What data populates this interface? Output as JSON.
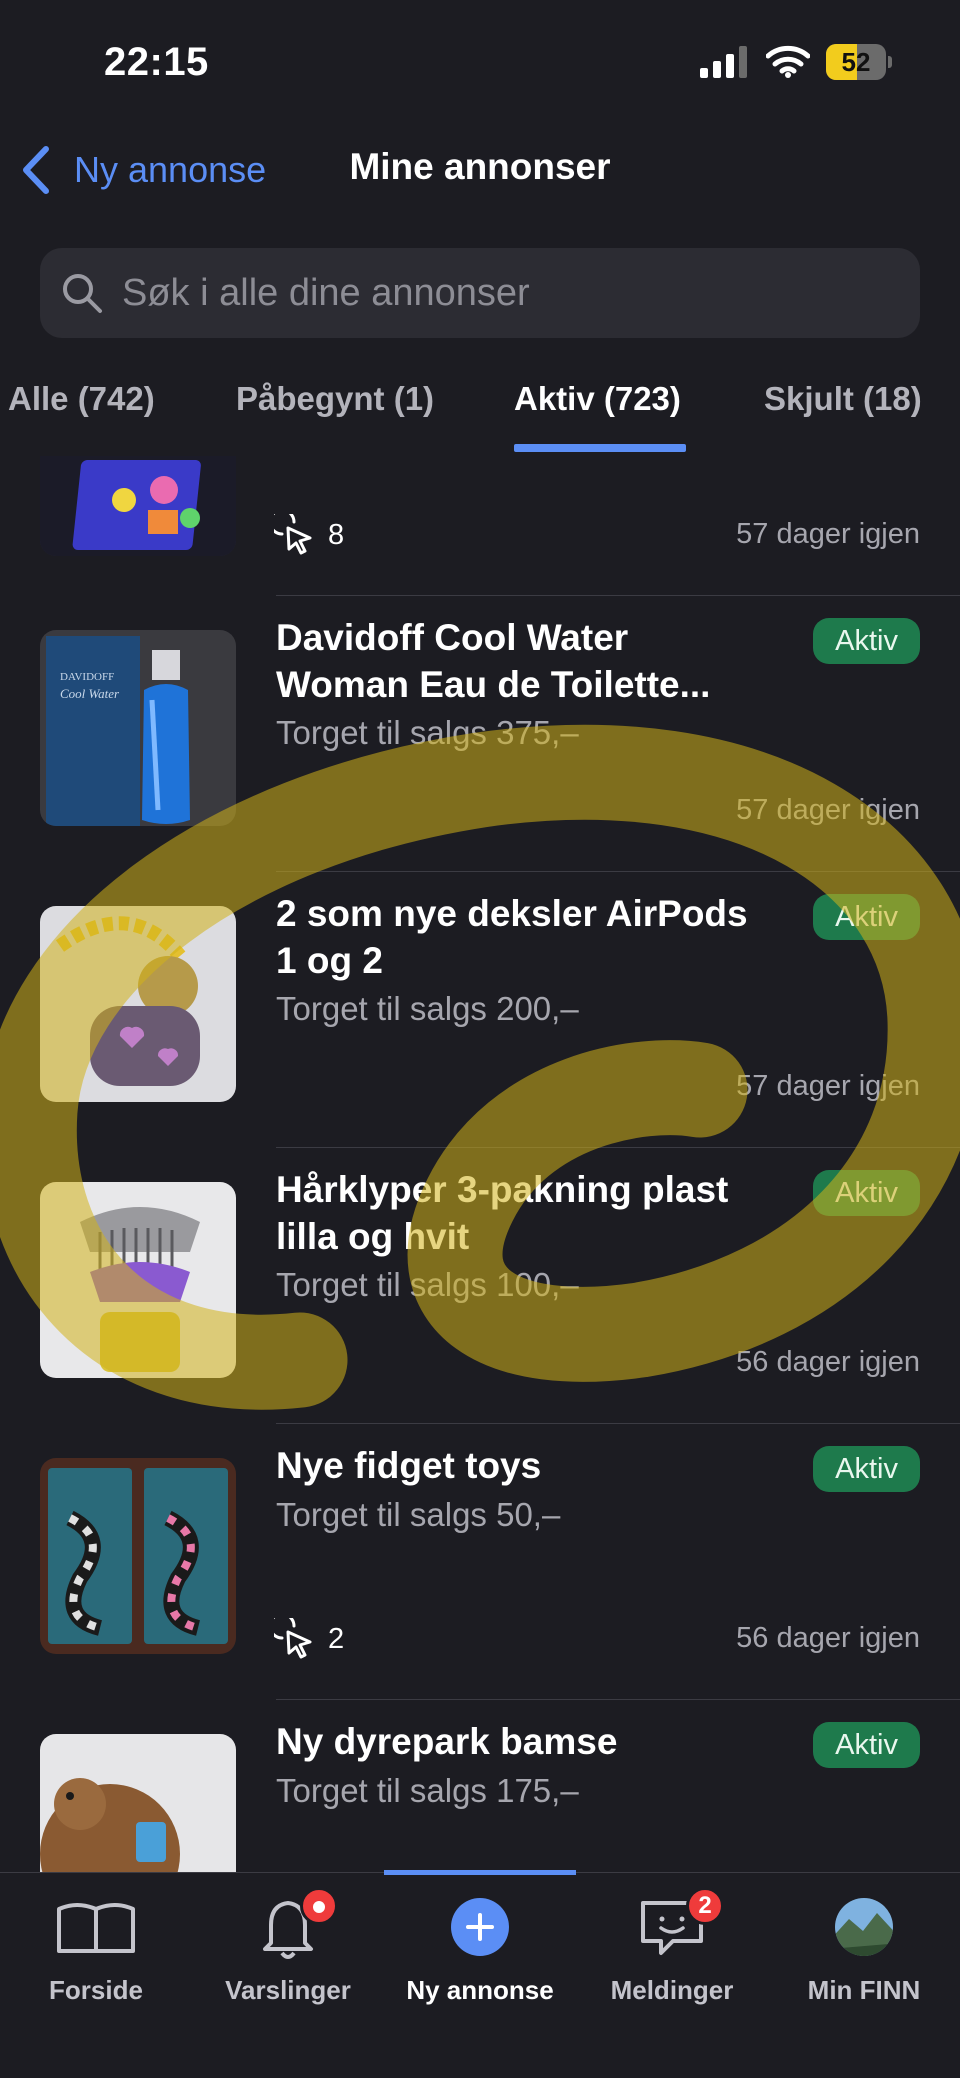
{
  "status_bar": {
    "time": "22:15",
    "battery": "52",
    "battery_level": 52
  },
  "nav": {
    "back_label": "Ny annonse",
    "title": "Mine annonser"
  },
  "search": {
    "placeholder": "Søk i alle dine annonser"
  },
  "tabs": [
    {
      "label": "Alle (742)"
    },
    {
      "label": "Påbegynt (1)"
    },
    {
      "label": "Aktiv (723)",
      "active": true
    },
    {
      "label": "Skjult (18)"
    }
  ],
  "listings": [
    {
      "title": "",
      "clicks": "8",
      "days_left": "57 dager igjen"
    },
    {
      "title": "Davidoff Cool Water Woman Eau de Toilette...",
      "price": "Torget til salgs 375,–",
      "status": "Aktiv",
      "days_left": "57 dager igjen"
    },
    {
      "title": "2 som nye deksler AirPods 1 og 2",
      "price": "Torget til salgs 200,–",
      "status": "Aktiv",
      "days_left": "57 dager igjen"
    },
    {
      "title": "Hårklyper 3-pakning plast lilla og hvit",
      "price": "Torget til salgs 100,–",
      "status": "Aktiv",
      "days_left": "56 dager igjen"
    },
    {
      "title": "Nye fidget toys",
      "price": "Torget til salgs 50,–",
      "status": "Aktiv",
      "clicks": "2",
      "days_left": "56 dager igjen"
    },
    {
      "title": "Ny dyrepark bamse",
      "price": "Torget til salgs 175,–",
      "status": "Aktiv"
    }
  ],
  "bottom_nav": {
    "items": [
      {
        "label": "Forside",
        "icon": "book-icon"
      },
      {
        "label": "Varslinger",
        "icon": "bell-icon",
        "badge": ""
      },
      {
        "label": "Ny annonse",
        "icon": "plus-icon",
        "active": true
      },
      {
        "label": "Meldinger",
        "icon": "chat-icon",
        "badge": "2"
      },
      {
        "label": "Min FINN",
        "icon": "profile-avatar"
      }
    ]
  },
  "colors": {
    "accent": "#5b8ef5",
    "badge_green": "#1e7a4c",
    "background": "#1c1c22",
    "notification_red": "#ef3b3b"
  }
}
